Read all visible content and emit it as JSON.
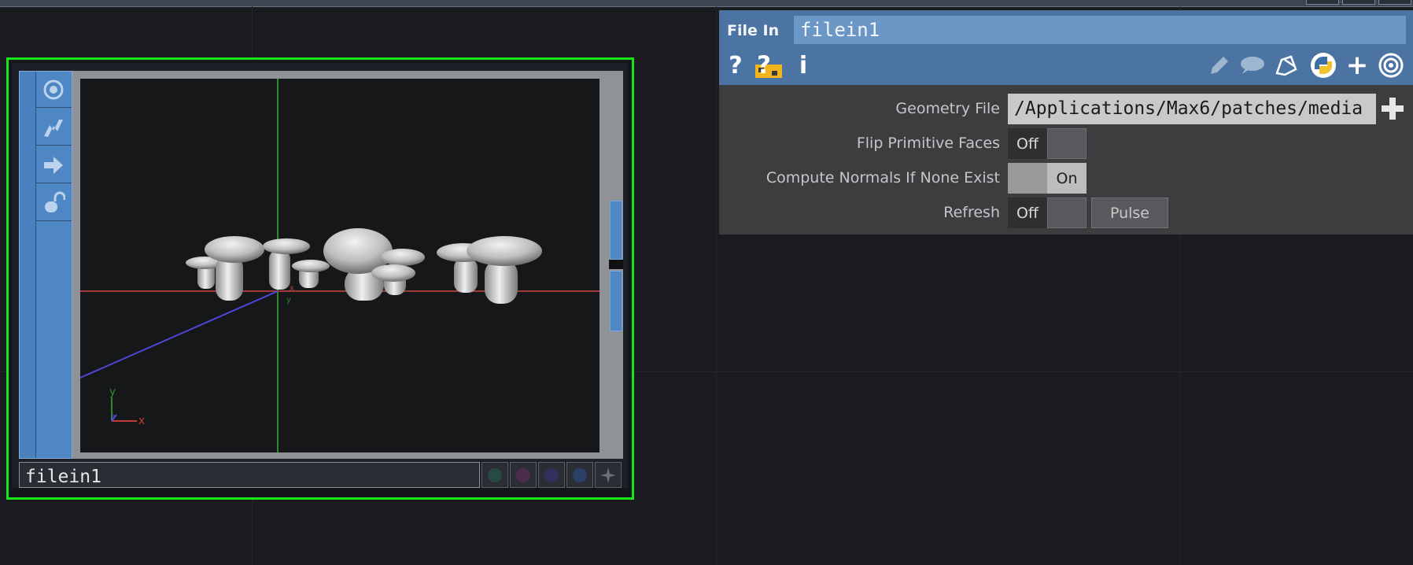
{
  "node": {
    "name": "filein1",
    "axis_labels": {
      "x": "x",
      "y": "y",
      "z": "z"
    }
  },
  "panel": {
    "operator_type": "File In",
    "operator_name": "filein1",
    "header_icons": [
      "help-icon",
      "python-help-icon",
      "info-icon",
      "edit-icon",
      "comment-icon",
      "clone-icon",
      "python-icon",
      "add-icon",
      "viewer-icon"
    ],
    "params": {
      "geometry_file": {
        "label": "Geometry File",
        "value": "/Applications/Max6/patches/media"
      },
      "flip_faces": {
        "label": "Flip Primitive Faces",
        "state_label": "Off"
      },
      "compute_normals": {
        "label": "Compute Normals If None Exist",
        "state_label": "On"
      },
      "refresh": {
        "label": "Refresh",
        "state_label": "Off",
        "pulse_label": "Pulse"
      }
    }
  },
  "colors": {
    "selection": "#19e619",
    "panel_header": "#4b74a3",
    "node_icons": "#4f86c4"
  }
}
